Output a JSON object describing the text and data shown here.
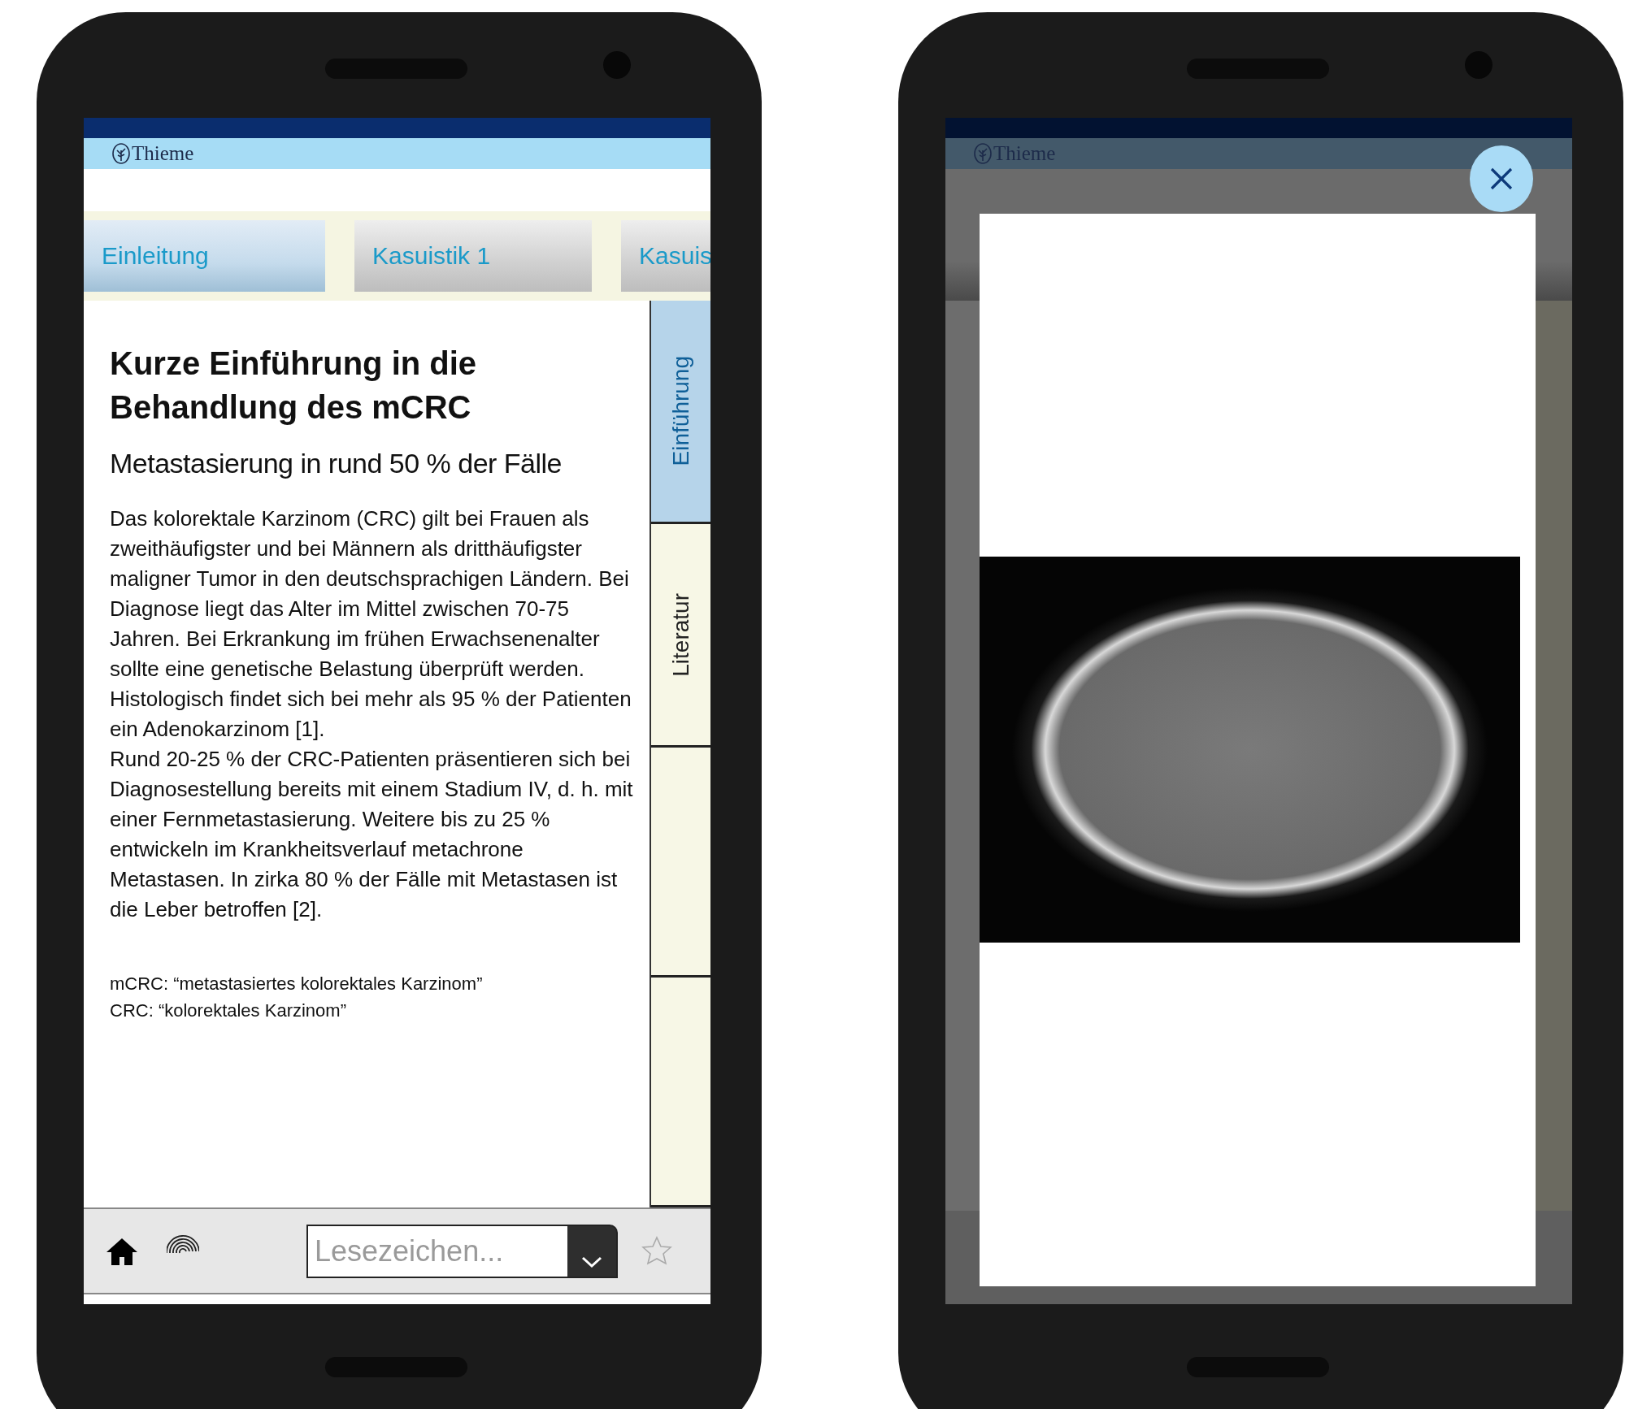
{
  "article_screen": {
    "brand": "Thieme",
    "tabs": [
      {
        "label": "Einleitung",
        "selected": true
      },
      {
        "label": "Kasuistik 1",
        "selected": false
      },
      {
        "label": "Kasuis",
        "selected": false
      }
    ],
    "title": "Kurze Einführung in die Behandlung des mCRC",
    "subtitle": "Metastasierung in rund 50 % der Fälle",
    "paragraphs": [
      "Das kolorektale Karzinom (CRC) gilt bei Frauen als zweithäufigster und bei Männern als dritthäufigster maligner Tumor in den deutschsprachigen Ländern. Bei Diagnose liegt das Alter im Mittel zwischen 70-75 Jahren. Bei Erkrankung im frühen Erwachsenenalter sollte eine genetische Belastung überprüft werden. Histologisch findet sich bei mehr als 95 % der Patienten ein Adenokarzinom [1].",
      "Rund 20-25 % der CRC-Patienten präsentieren sich bei Diagnosestellung bereits mit einem Stadium IV, d. h. mit einer Fernmetastasierung. Weitere bis zu 25 % entwickeln im Krankheitsverlauf metachrone Metastasen. In zirka 80 % der Fälle mit Metastasen ist die Leber betroffen [2]."
    ],
    "footnotes": [
      "mCRC: “metastasiertes kolorektales Karzinom”",
      "CRC: “kolorektales Karzinom”"
    ],
    "side_tabs": [
      {
        "label": "Einführung",
        "selected": true
      },
      {
        "label": "Literatur",
        "selected": false
      }
    ],
    "bookmark_field": {
      "placeholder": "Lesezeichen..."
    }
  },
  "image_viewer_screen": {
    "brand": "Thieme"
  }
}
